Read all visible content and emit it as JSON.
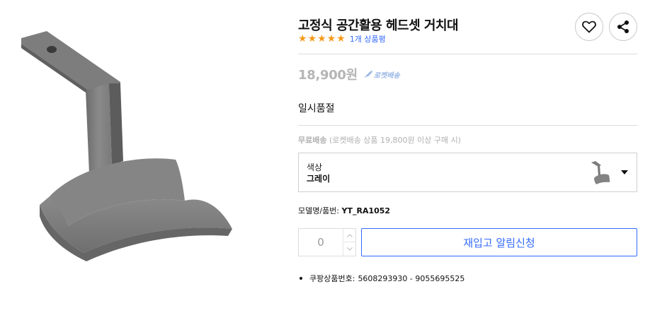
{
  "product": {
    "title": "고정식 공간활용 헤드셋 거치대",
    "rating_stars": 5,
    "review_count": "1개 상품평",
    "price": "18,900원",
    "rocket_label": "로켓배송",
    "status": "일시품절"
  },
  "shipping": {
    "free_label": "무료배송",
    "condition": "(로켓배송 상품 19,800원 이상 구매 시)"
  },
  "option": {
    "label": "색상",
    "value": "그레이"
  },
  "model": {
    "label": "모델명/품번:",
    "value": "YT_RA1052"
  },
  "quantity": {
    "value": "0"
  },
  "restock_button": "재입고 알림신청",
  "product_number": {
    "label": "쿠팡상품번호:",
    "value": "5608293930 - 9055695525"
  },
  "icons": {
    "wishlist": "heart-icon",
    "share": "share-icon",
    "dropdown": "caret-down-icon",
    "rocket": "rocket-icon"
  },
  "colors": {
    "accent": "#346aff",
    "star": "#f59a1a",
    "price_disabled": "#b5b5b5"
  }
}
